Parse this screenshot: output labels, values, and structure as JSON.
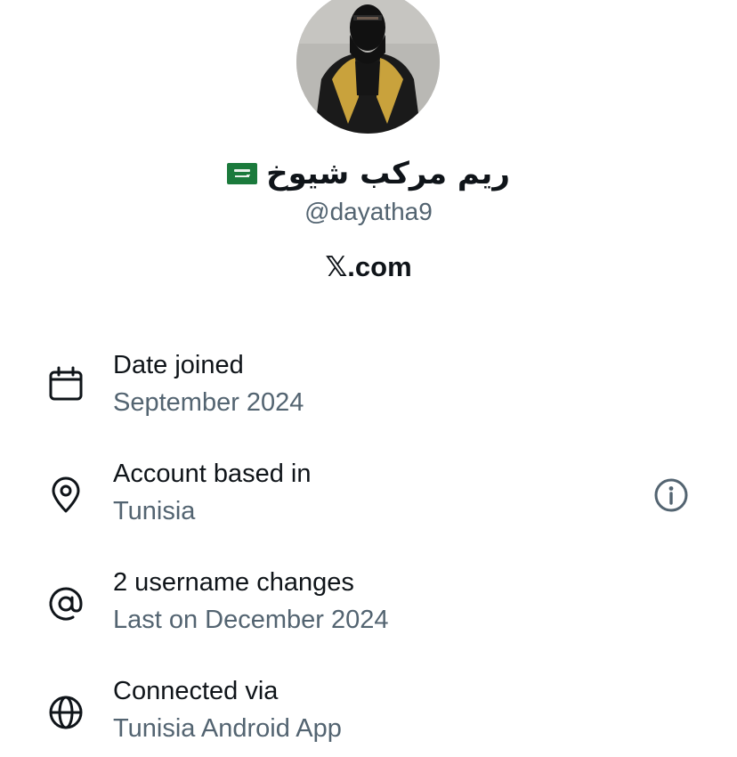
{
  "profile": {
    "display_name": "ريم مركب شيوخ",
    "flag_icon": "saudi-arabia-flag-icon",
    "handle": "@dayatha9",
    "site": "𝕏.com"
  },
  "details": [
    {
      "icon": "calendar-icon",
      "title": "Date joined",
      "value": "September 2024"
    },
    {
      "icon": "location-pin-icon",
      "title": "Account based in",
      "value": "Tunisia",
      "action_icon": "info-icon"
    },
    {
      "icon": "at-sign-icon",
      "title": "2 username changes",
      "value": "Last on December 2024"
    },
    {
      "icon": "globe-icon",
      "title": "Connected via",
      "value": "Tunisia Android App"
    }
  ],
  "colors": {
    "primary_text": "#0f1419",
    "secondary_text": "#536471",
    "flag_green": "#1b7a3c",
    "background": "#ffffff"
  }
}
